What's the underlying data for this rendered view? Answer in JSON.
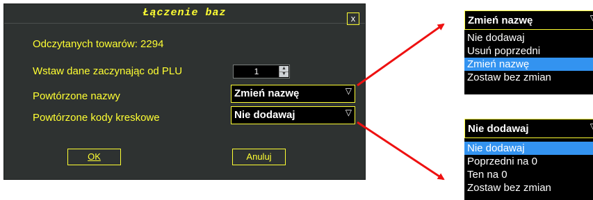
{
  "dialog": {
    "title": "Łączenie baz",
    "close_label": "x",
    "read_count_label": "Odczytanych towarów: 2294",
    "plu_start_label": "Wstaw dane zaczynając od PLU",
    "plu_start_value": "1",
    "dup_names_label": "Powtórzone nazwy",
    "dup_names_value": "Zmień nazwę",
    "dup_barcodes_label": "Powtórzone kody kreskowe",
    "dup_barcodes_value": "Nie dodawaj",
    "ok_label": "OK",
    "cancel_label": "Anuluj"
  },
  "names_dropdown": {
    "value": "Zmień nazwę",
    "options": [
      "Nie dodawaj",
      "Usuń poprzedni",
      "Zmień nazwę",
      "Zostaw bez zmian"
    ],
    "selected_index": 2
  },
  "barcodes_dropdown": {
    "value": "Nie dodawaj",
    "options": [
      "Nie dodawaj",
      "Poprzedni na 0",
      "Ten na 0",
      "Zostaw bez zmian"
    ],
    "selected_index": 0
  },
  "colors": {
    "dialog_bg": "#2e3231",
    "accent": "#ffff33",
    "selection": "#3393f0",
    "arrow": "#ee1111"
  }
}
